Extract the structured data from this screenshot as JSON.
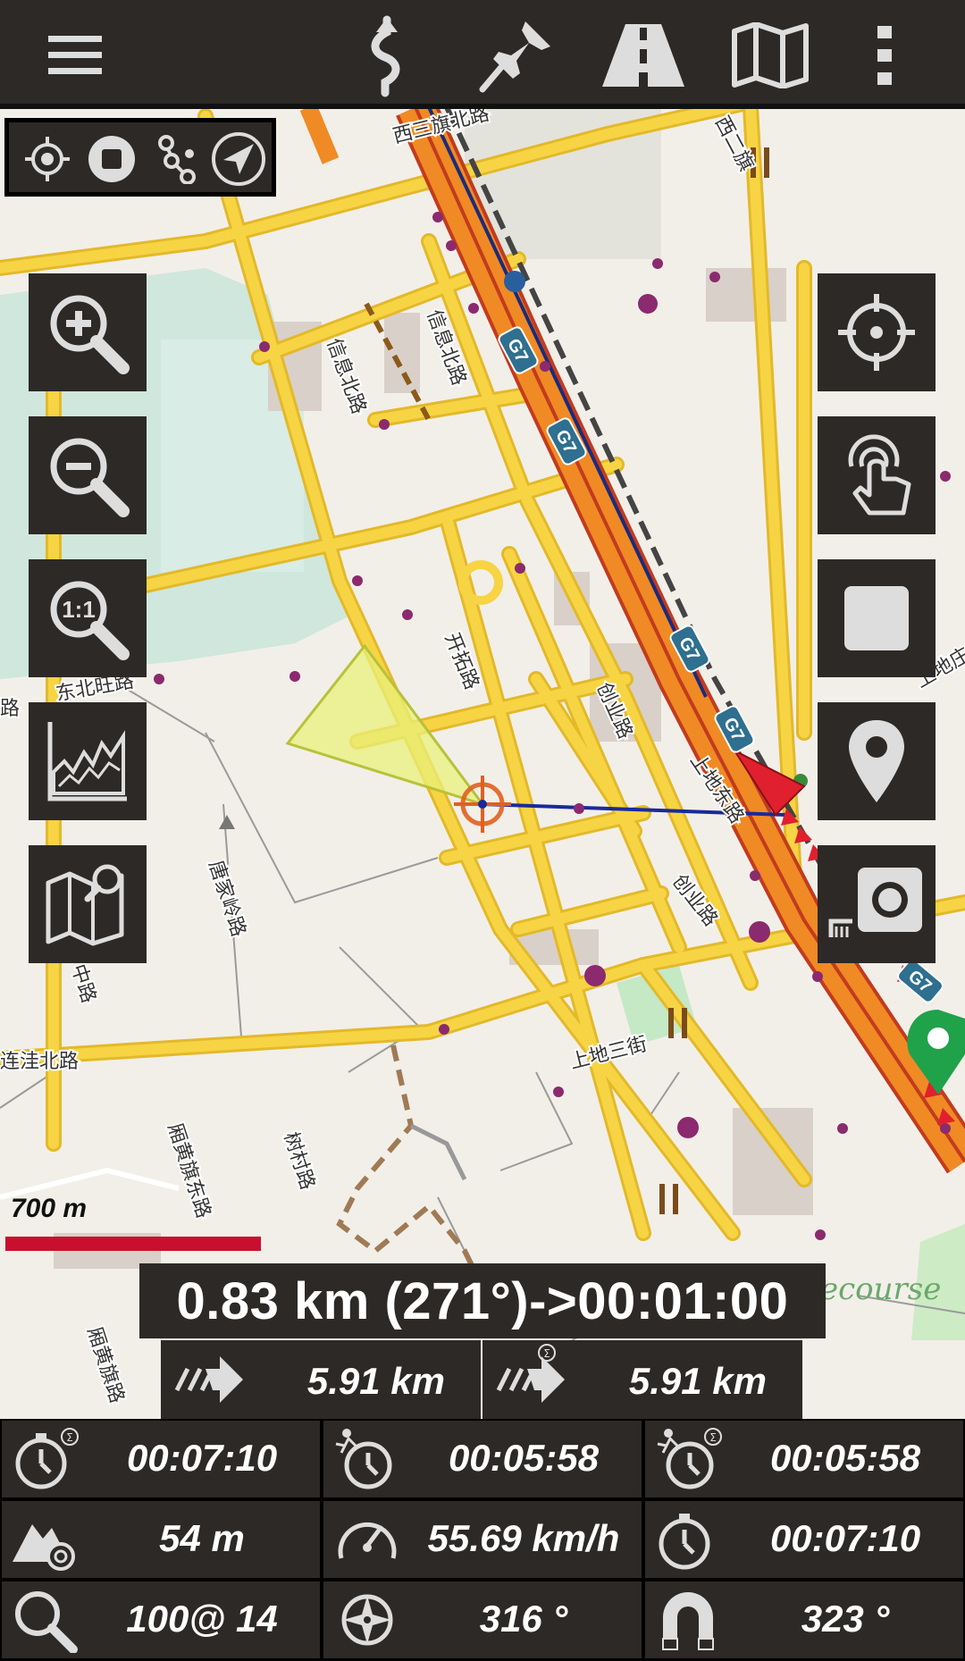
{
  "toolbar": {
    "menu_icon": "hamburger-menu-icon",
    "route_icon": "route-icon",
    "pin_icon": "pushpin-icon",
    "road_icon": "road-icon",
    "map_icon": "map-icon",
    "more_icon": "more-vertical-icon"
  },
  "minibar": {
    "icons": [
      "gps-target-icon",
      "stop-icon",
      "track-nodes-icon",
      "navigate-arrow-icon"
    ]
  },
  "left_buttons": [
    "zoom-in-icon",
    "zoom-out-icon",
    "zoom-1-1-icon",
    "elevation-chart-icon",
    "map-search-icon"
  ],
  "left_zoom_label": "1:1",
  "right_buttons": [
    "center-crosshair-icon",
    "touch-icon",
    "stop-record-icon",
    "location-pin-icon",
    "camera-icon"
  ],
  "map": {
    "road_labels": {
      "xisanqi": "西三旗北路",
      "xi_er": "西二旗",
      "xinxi_bei_1": "信息北路",
      "xinxi_bei_2": "信息北路",
      "kaituo": "开拓路",
      "chuangye_1": "创业路",
      "chuangye_2": "创业路",
      "shangdi_dong": "上地东路",
      "dongbeiwang": "东北旺路",
      "tangjialing": "唐家岭路",
      "lianwa_bei": "连洼北路",
      "shangdi_3": "上地三街",
      "xiang_huang_dong": "厢黄旗东路",
      "shucun": "树村路",
      "xiang_huang": "厢黄旗路",
      "zhong": "中路",
      "shangdi_right": "上地庄",
      "ring": "G7",
      "course": "ecourse",
      "lu_left": "路"
    },
    "highway_shields": [
      "G7",
      "G7",
      "G7",
      "G7",
      "G7"
    ]
  },
  "scale": {
    "label": "700 m"
  },
  "navigation": {
    "distance_banner": "0.83 km (271°)->00:01:00",
    "to_target": "5.91 km",
    "to_target_total": "5.91 km"
  },
  "stats": [
    {
      "icon": "stopwatch-sum-icon",
      "value": "00:07:10"
    },
    {
      "icon": "moving-time-icon",
      "value": "00:05:58"
    },
    {
      "icon": "moving-time-sum-icon",
      "value": "00:05:58"
    },
    {
      "icon": "altitude-icon",
      "value": "54 m"
    },
    {
      "icon": "speedometer-icon",
      "value": "55.69 km/h"
    },
    {
      "icon": "stopwatch-icon",
      "value": "00:07:10"
    },
    {
      "icon": "zoom-level-icon",
      "value": "100@ 14"
    },
    {
      "icon": "compass-icon",
      "value": "316 °"
    },
    {
      "icon": "magnet-icon",
      "value": "323 °"
    }
  ],
  "colors": {
    "panel_bg": "#2d2926",
    "highway_orange": "#f08a24",
    "road_yellow": "#f7d444",
    "scale_red": "#c8102e",
    "target_red": "#e0202e",
    "poi_purple": "#8b2a6e"
  }
}
